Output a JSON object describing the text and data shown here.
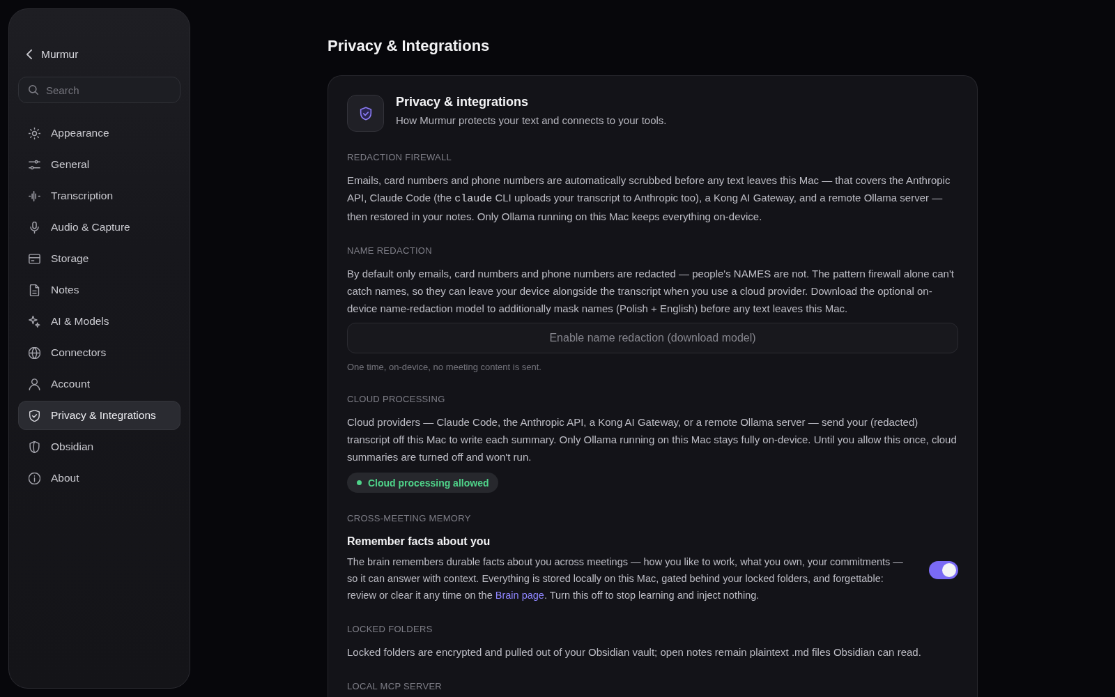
{
  "sidebar": {
    "back": {
      "label": "Murmur"
    },
    "search": {
      "placeholder": "Search"
    },
    "items": [
      {
        "label": "Appearance",
        "selected": false
      },
      {
        "label": "General",
        "selected": false
      },
      {
        "label": "Transcription",
        "selected": false
      },
      {
        "label": "Audio & Capture",
        "selected": false
      },
      {
        "label": "Storage",
        "selected": false
      },
      {
        "label": "Notes",
        "selected": false
      },
      {
        "label": "AI & Models",
        "selected": false
      },
      {
        "label": "Connectors",
        "selected": false
      },
      {
        "label": "Account",
        "selected": false
      },
      {
        "label": "Privacy & Integrations",
        "selected": true
      },
      {
        "label": "Obsidian",
        "selected": false
      },
      {
        "label": "About",
        "selected": false
      }
    ]
  },
  "page": {
    "title": "Privacy & Integrations"
  },
  "card": {
    "title": "Privacy & integrations",
    "subtitle": "How Murmur protects your text and connects to your tools.",
    "sections": [
      {
        "kind": "info",
        "heading": "REDACTION FIREWALL",
        "body": [
          {
            "kind": "text",
            "text": "Emails, card numbers and phone numbers are automatically scrubbed before any text leaves this Mac — that covers the Anthropic API, Claude Code (the "
          },
          {
            "kind": "code",
            "text": "claude"
          },
          {
            "kind": "text",
            "text": " CLI uploads your transcript to Anthropic too), a Kong AI Gateway, and a remote Ollama server — then restored in your notes. Only Ollama running on this Mac keeps everything on-device."
          }
        ]
      },
      {
        "kind": "download",
        "heading": "NAME REDACTION",
        "body": [
          {
            "kind": "text",
            "text": "By default only emails, card numbers and phone numbers are redacted — people's NAMES are not. The pattern firewall alone can't catch names, so they can leave your device alongside the transcript when you use a cloud provider. Download the optional on-device name-redaction model to additionally mask names (Polish + English) before any text leaves this Mac."
          }
        ],
        "button": "Enable name redaction (download model)",
        "hint": "One time, on-device, no meeting content is sent."
      },
      {
        "kind": "consent",
        "heading": "CLOUD PROCESSING",
        "body": [
          {
            "kind": "text",
            "text": "Cloud providers — Claude Code, the Anthropic API, a Kong AI Gateway, or a remote Ollama server — send your (redacted) transcript off this Mac to write each summary. Only Ollama running on this Mac stays fully on-device. Until you allow this once, cloud summaries are turned off and won't run."
          }
        ],
        "status": {
          "label": "Cloud processing allowed",
          "allowed": true
        }
      },
      {
        "kind": "toggle",
        "heading": "CROSS-MEETING MEMORY",
        "setting": {
          "title": "Remember facts about you",
          "on": true
        },
        "body": [
          {
            "kind": "text",
            "text": "The brain remembers durable facts about you across meetings — how you like to work, what you own, your commitments — so it can answer with context. Everything is stored locally on this Mac, gated behind your locked folders, and forgettable: review or clear it any time on the "
          },
          {
            "kind": "link",
            "text": "Brain page"
          },
          {
            "kind": "text",
            "text": ". Turn this off to stop learning and inject nothing."
          }
        ]
      },
      {
        "kind": "info",
        "heading": "LOCKED FOLDERS",
        "body": [
          {
            "kind": "text",
            "text": "Locked folders are encrypted and pulled out of your Obsidian vault; open notes remain plaintext .md files Obsidian can read."
          }
        ]
      },
      {
        "kind": "info",
        "heading": "LOCAL MCP SERVER"
      }
    ]
  }
}
